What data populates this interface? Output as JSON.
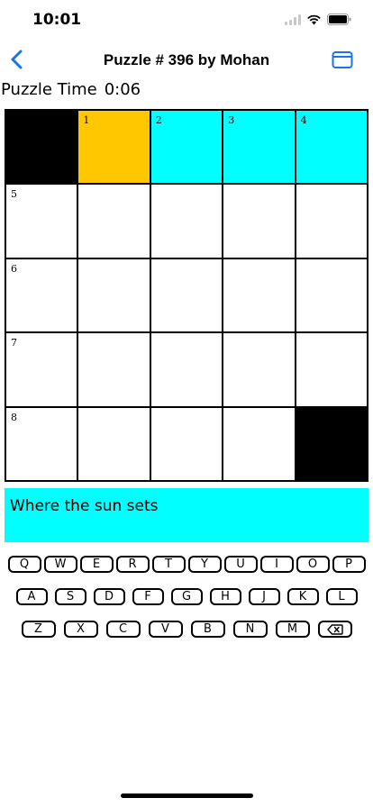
{
  "status": {
    "time": "10:01"
  },
  "nav": {
    "title": "Puzzle # 396 by Mohan"
  },
  "timer": {
    "label": "Puzzle Time",
    "value": "0:06"
  },
  "grid": {
    "rows": [
      [
        {
          "type": "black",
          "number": ""
        },
        {
          "type": "active",
          "number": "1"
        },
        {
          "type": "highlight",
          "number": "2"
        },
        {
          "type": "highlight",
          "number": "3"
        },
        {
          "type": "highlight",
          "number": "4"
        }
      ],
      [
        {
          "type": "white",
          "number": "5"
        },
        {
          "type": "white",
          "number": ""
        },
        {
          "type": "white",
          "number": ""
        },
        {
          "type": "white",
          "number": ""
        },
        {
          "type": "white",
          "number": ""
        }
      ],
      [
        {
          "type": "white",
          "number": "6"
        },
        {
          "type": "white",
          "number": ""
        },
        {
          "type": "white",
          "number": ""
        },
        {
          "type": "white",
          "number": ""
        },
        {
          "type": "white",
          "number": ""
        }
      ],
      [
        {
          "type": "white",
          "number": "7"
        },
        {
          "type": "white",
          "number": ""
        },
        {
          "type": "white",
          "number": ""
        },
        {
          "type": "white",
          "number": ""
        },
        {
          "type": "white",
          "number": ""
        }
      ],
      [
        {
          "type": "white",
          "number": "8"
        },
        {
          "type": "white",
          "number": ""
        },
        {
          "type": "white",
          "number": ""
        },
        {
          "type": "white",
          "number": ""
        },
        {
          "type": "black",
          "number": ""
        }
      ]
    ]
  },
  "clue": {
    "text": "Where the sun sets"
  },
  "keyboard": {
    "row1": [
      "Q",
      "W",
      "E",
      "R",
      "T",
      "Y",
      "U",
      "I",
      "O",
      "P"
    ],
    "row2": [
      "A",
      "S",
      "D",
      "F",
      "G",
      "H",
      "J",
      "K",
      "L"
    ],
    "row3": [
      "Z",
      "X",
      "C",
      "V",
      "B",
      "N",
      "M"
    ],
    "delete_icon": "delete-backward-icon"
  },
  "colors": {
    "active": "#ffc700",
    "highlight": "#00ffff",
    "accent": "#1a73e8",
    "block": "#000000"
  }
}
